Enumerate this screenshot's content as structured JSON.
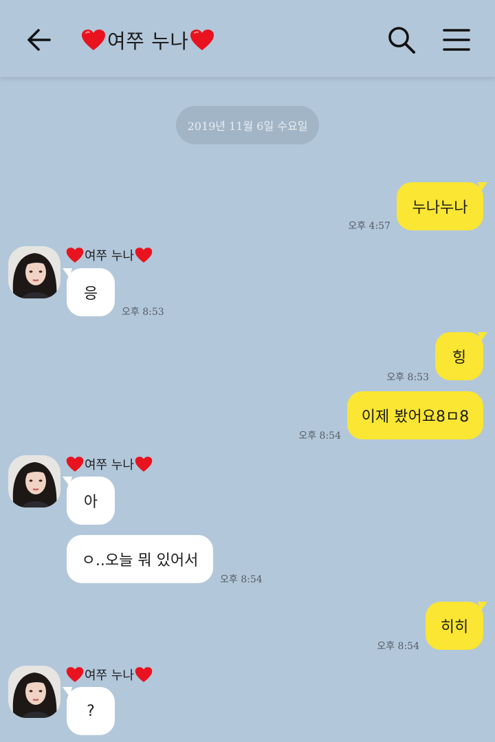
{
  "header": {
    "title": "여쭈 누나"
  },
  "date_divider": "2019년 11월 6일 수요일",
  "sender_name": "여쭈 누나",
  "colors": {
    "background": "#b2c7da",
    "my_bubble": "#fae633",
    "their_bubble": "#ffffff",
    "heart": "#e8131f"
  },
  "messages": [
    {
      "from": "me",
      "text": "누나누나",
      "time": "오후 4:57"
    },
    {
      "from": "other",
      "text": "응",
      "time": "오후 8:53"
    },
    {
      "from": "me",
      "text": "힝",
      "time": "오후 8:53"
    },
    {
      "from": "me",
      "text": "이제 봤어요8ㅁ8",
      "time": "오후 8:54"
    },
    {
      "from": "other",
      "text": "아",
      "time": ""
    },
    {
      "from": "other",
      "text": "ㅇ..오늘 뭐 있어서",
      "time": "오후 8:54"
    },
    {
      "from": "me",
      "text": "히히",
      "time": "오후 8:54"
    },
    {
      "from": "other",
      "text": "?",
      "time": ""
    }
  ],
  "icons": [
    "back-arrow-icon",
    "heart-icon",
    "search-icon",
    "menu-icon"
  ]
}
